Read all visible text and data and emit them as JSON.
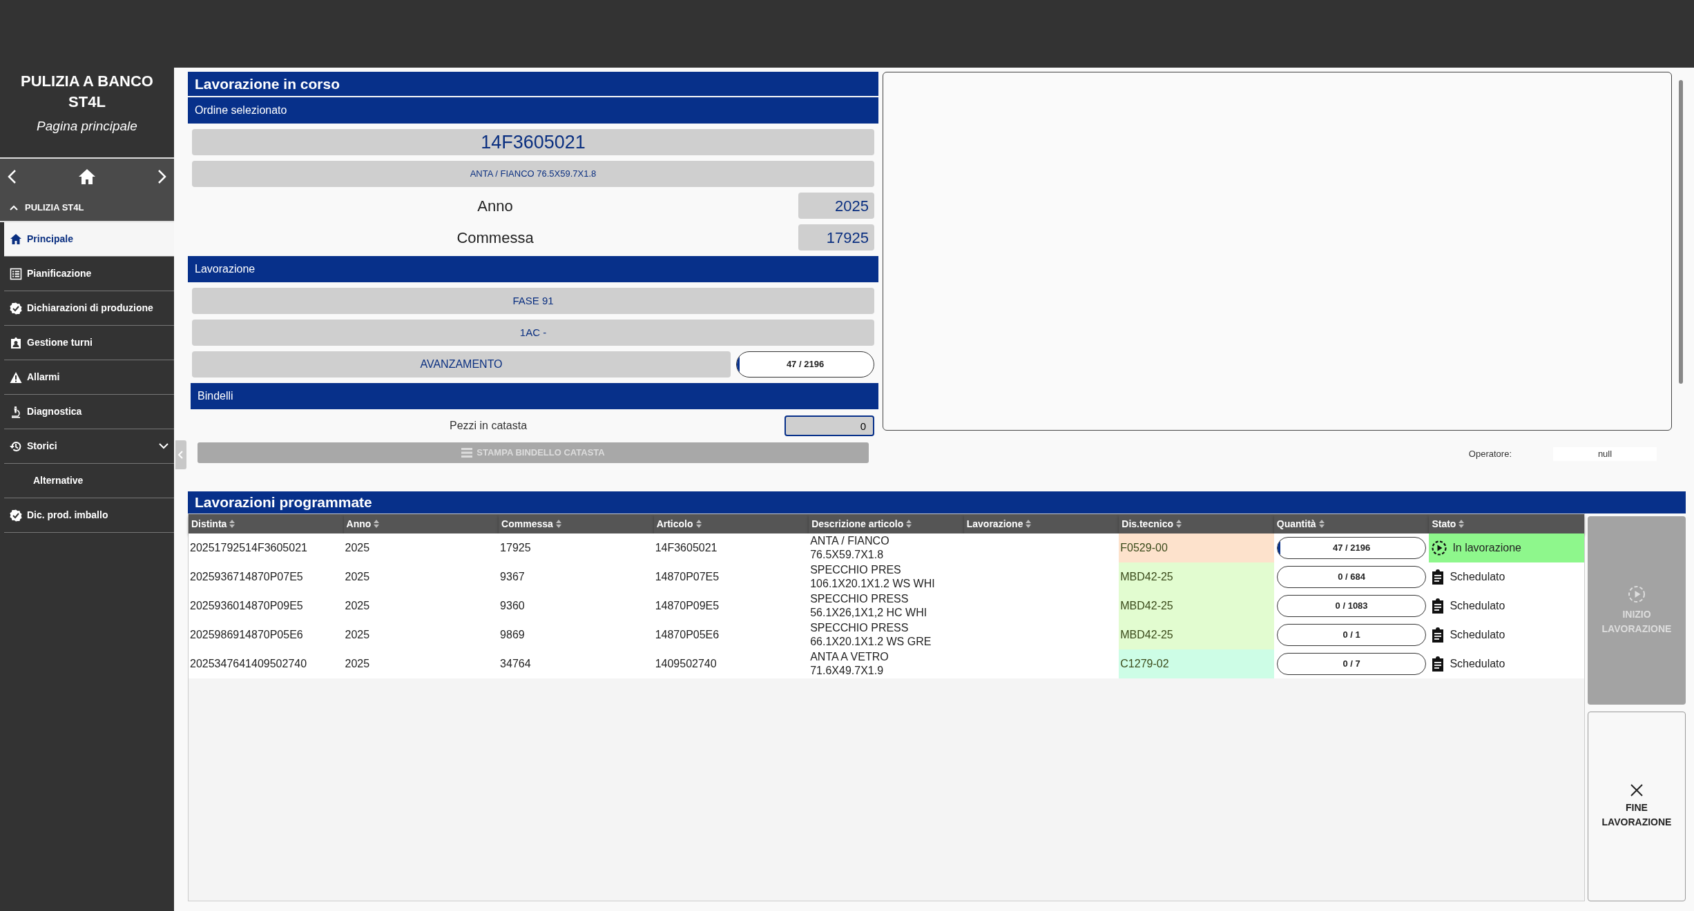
{
  "app": {
    "title": "PULIZIA A BANCO ST4L",
    "subtitle": "Pagina principale"
  },
  "nav_group": {
    "label": "PULIZIA ST4L",
    "expanded": true
  },
  "sidebar": {
    "items": [
      {
        "label": "Principale",
        "kind": "link",
        "selected": true
      },
      {
        "label": "Pianificazione",
        "kind": "link",
        "selected": false
      },
      {
        "label": "Dichiarazioni di produzione",
        "kind": "link",
        "selected": false
      },
      {
        "label": "Gestione turni",
        "kind": "link",
        "selected": false
      },
      {
        "label": "Allarmi",
        "kind": "link",
        "selected": false
      },
      {
        "label": "Diagnostica",
        "kind": "link",
        "selected": false
      },
      {
        "label": "Storici",
        "kind": "group",
        "expanded": false,
        "selected": false
      },
      {
        "label": "Alternative",
        "kind": "sub",
        "selected": false
      },
      {
        "label": "Dic. prod. imballo",
        "kind": "link",
        "selected": false
      }
    ]
  },
  "current": {
    "title": "Lavorazione in corso",
    "order_header": "Ordine selezionato",
    "order_code": "14F3605021",
    "description": "ANTA / FIANCO 76.5X59.7X1.8",
    "fields": [
      {
        "label": "Anno",
        "value": "2025"
      },
      {
        "label": "Commessa",
        "value": "17925"
      }
    ],
    "work_header": "Lavorazione",
    "phase": "FASE 91",
    "cycle": "1AC -",
    "progress": {
      "label": "AVANZAMENTO",
      "reading": "47 / 2196",
      "level": 0.021
    },
    "bindelli_header": "Bindelli",
    "pieces": {
      "label": "Pezzi in catasta",
      "value": "0"
    },
    "print_button": {
      "label": "STAMPA BINDELLO CATASTA",
      "disabled": true
    }
  },
  "operator": {
    "label": "Operatore:",
    "value": "null"
  },
  "table": {
    "title": "Lavorazioni programmate",
    "columns": [
      "Distinta",
      "Anno",
      "Commessa",
      "Articolo",
      "Descrizione articolo",
      "Lavorazione",
      "Dis.tecnico",
      "Quantità",
      "Stato"
    ],
    "rows": [
      {
        "distinta": "20251792514F3605021",
        "anno": "2025",
        "commessa": "17925",
        "articolo": "14F3605021",
        "descrizione": "ANTA / FIANCO 76.5X59.7X1.8",
        "dis_tecnico": {
          "text": "F0529-00",
          "color": "#fde2cc"
        },
        "quantita": {
          "reading": "47 / 2196",
          "level": 0.021
        },
        "stato": {
          "label": "In lavorazione",
          "kind": "running"
        }
      },
      {
        "distinta": "2025936714870P07E5",
        "anno": "2025",
        "commessa": "9367",
        "articolo": "14870P07E5",
        "descrizione": "SPECCHIO PRES 106.1X20.1X1.2 WS WHI",
        "dis_tecnico": {
          "text": "MBD42-25",
          "color": "#e2fcd0"
        },
        "quantita": {
          "reading": "0 / 684",
          "level": 0
        },
        "stato": {
          "label": "Schedulato",
          "kind": "scheduled"
        }
      },
      {
        "distinta": "2025936014870P09E5",
        "anno": "2025",
        "commessa": "9360",
        "articolo": "14870P09E5",
        "descrizione": "SPECCHIO PRESS 56.1X26,1X1,2 HC WHI",
        "dis_tecnico": {
          "text": "MBD42-25",
          "color": "#e2fcd0"
        },
        "quantita": {
          "reading": "0 / 1083",
          "level": 0
        },
        "stato": {
          "label": "Schedulato",
          "kind": "scheduled"
        }
      },
      {
        "distinta": "2025986914870P05E6",
        "anno": "2025",
        "commessa": "9869",
        "articolo": "14870P05E6",
        "descrizione": "SPECCHIO PRESS 66.1X20.1X1.2 WS GRE",
        "dis_tecnico": {
          "text": "MBD42-25",
          "color": "#e2fcd0"
        },
        "quantita": {
          "reading": "0 / 1",
          "level": 0
        },
        "stato": {
          "label": "Schedulato",
          "kind": "scheduled"
        }
      },
      {
        "distinta": "2025347641409502740",
        "anno": "2025",
        "commessa": "34764",
        "articolo": "1409502740",
        "descrizione": "ANTA A VETRO 71.6X49.7X1.9",
        "dis_tecnico": {
          "text": "C1279-02",
          "color": "#cdfde6"
        },
        "quantita": {
          "reading": "0 / 7",
          "level": 0
        },
        "stato": {
          "label": "Schedulato",
          "kind": "scheduled"
        }
      }
    ]
  },
  "actions": [
    {
      "label": "INIZIO LAVORAZIONE",
      "kind": "start",
      "disabled": true
    },
    {
      "label": "FINE LAVORAZIONE",
      "kind": "end",
      "disabled": false
    }
  ]
}
